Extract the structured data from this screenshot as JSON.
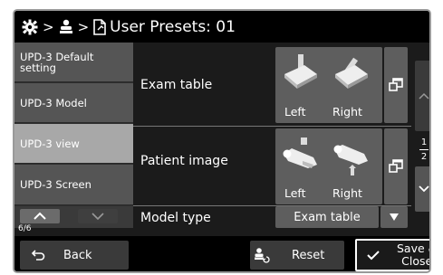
{
  "header": {
    "title": "User Presets: 01",
    "icons": [
      "gear-icon",
      "user-icon",
      "document-icon"
    ]
  },
  "sidebar": {
    "items": [
      {
        "label": "UPD-3 Default setting",
        "active": false
      },
      {
        "label": "UPD-3 Model",
        "active": false
      },
      {
        "label": "UPD-3 view",
        "active": true
      },
      {
        "label": "UPD-3 Screen",
        "active": false
      }
    ],
    "page_indicator": "6/6"
  },
  "main": {
    "exam_table": {
      "label": "Exam table",
      "left_label": "Left",
      "right_label": "Right"
    },
    "patient_image": {
      "label": "Patient image",
      "left_label": "Left",
      "right_label": "Right"
    },
    "model_type": {
      "label": "Model type",
      "value": "Exam table"
    }
  },
  "scroll": {
    "page_current": "1",
    "page_total": "2"
  },
  "footer": {
    "back_label": "Back",
    "reset_label": "Reset",
    "save_label": "Save &\nClose"
  },
  "colors": {
    "background": "#1b1b1b",
    "button": "#5e5e5e",
    "active_item": "#a8a8a8"
  }
}
